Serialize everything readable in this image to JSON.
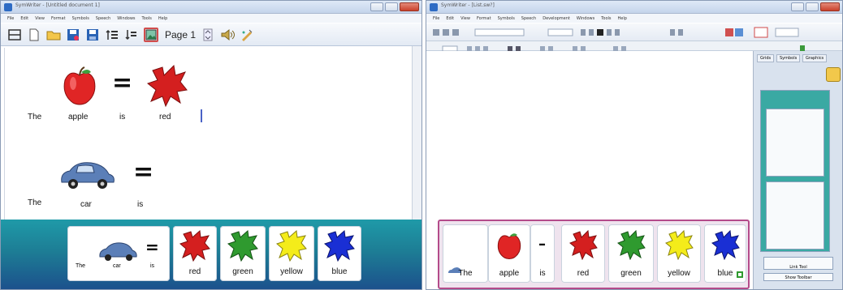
{
  "left": {
    "title": "SymWriter - [Untitled document 1]",
    "menu": [
      "File",
      "Edit",
      "View",
      "Format",
      "Symbols",
      "Speech",
      "Windows",
      "Tools",
      "Help"
    ],
    "page_label": "Page 1",
    "doc": {
      "line1": [
        "The",
        "apple",
        "is",
        "red"
      ],
      "line2": [
        "The",
        "car",
        "is"
      ]
    },
    "grid_cells": [
      {
        "label": "",
        "words": [
          "The",
          "car",
          "is"
        ]
      },
      {
        "label": "red"
      },
      {
        "label": "green"
      },
      {
        "label": "yellow"
      },
      {
        "label": "blue"
      }
    ]
  },
  "right": {
    "title": "SymWriter - [List.sw?]",
    "menu": [
      "File",
      "Edit",
      "View",
      "Format",
      "Symbols",
      "Speech",
      "Development",
      "Windows",
      "Tools",
      "Help"
    ],
    "panel_tabs": [
      "Grids",
      "Symbols",
      "Graphics"
    ],
    "panel_buttons": [
      "Link Tool",
      "Show Toolbar"
    ],
    "grid_cells": [
      {
        "label": "The"
      },
      {
        "label": "apple"
      },
      {
        "label": "is"
      },
      {
        "label": "red"
      },
      {
        "label": "green"
      },
      {
        "label": "yellow"
      },
      {
        "label": "blue"
      }
    ]
  },
  "colors": {
    "red": "#d41f1f",
    "green": "#2f9a2f",
    "yellow": "#f4ec1a",
    "blue": "#1a2fd4",
    "grid_bg": "#1d7d95"
  }
}
